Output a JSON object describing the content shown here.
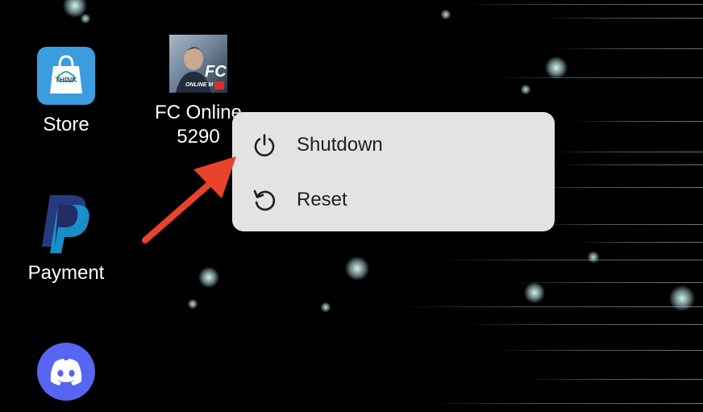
{
  "desktop": {
    "apps": [
      {
        "label": "Store",
        "icon": "think-store-icon",
        "badge_text": "THINK"
      },
      {
        "label": "FC Online\n5290",
        "label_line1": "FC Online",
        "label_line2": "5290",
        "icon": "fc-online-icon",
        "art_text": "FC",
        "art_subtext": "ONLINE M"
      },
      {
        "label": "Payment",
        "icon": "paypal-icon"
      },
      {
        "label": "",
        "icon": "discord-icon"
      }
    ]
  },
  "context_menu": {
    "items": [
      {
        "label": "Shutdown",
        "icon": "power-icon"
      },
      {
        "label": "Reset",
        "icon": "reset-icon"
      }
    ]
  },
  "annotation": {
    "arrow_color": "#E8432D"
  },
  "colors": {
    "menu_bg": "#e3e3e3",
    "store_blue": "#3c9ce0",
    "discord_blurple": "#5865F2",
    "paypal_dark": "#253b80",
    "paypal_light": "#179bd7"
  }
}
